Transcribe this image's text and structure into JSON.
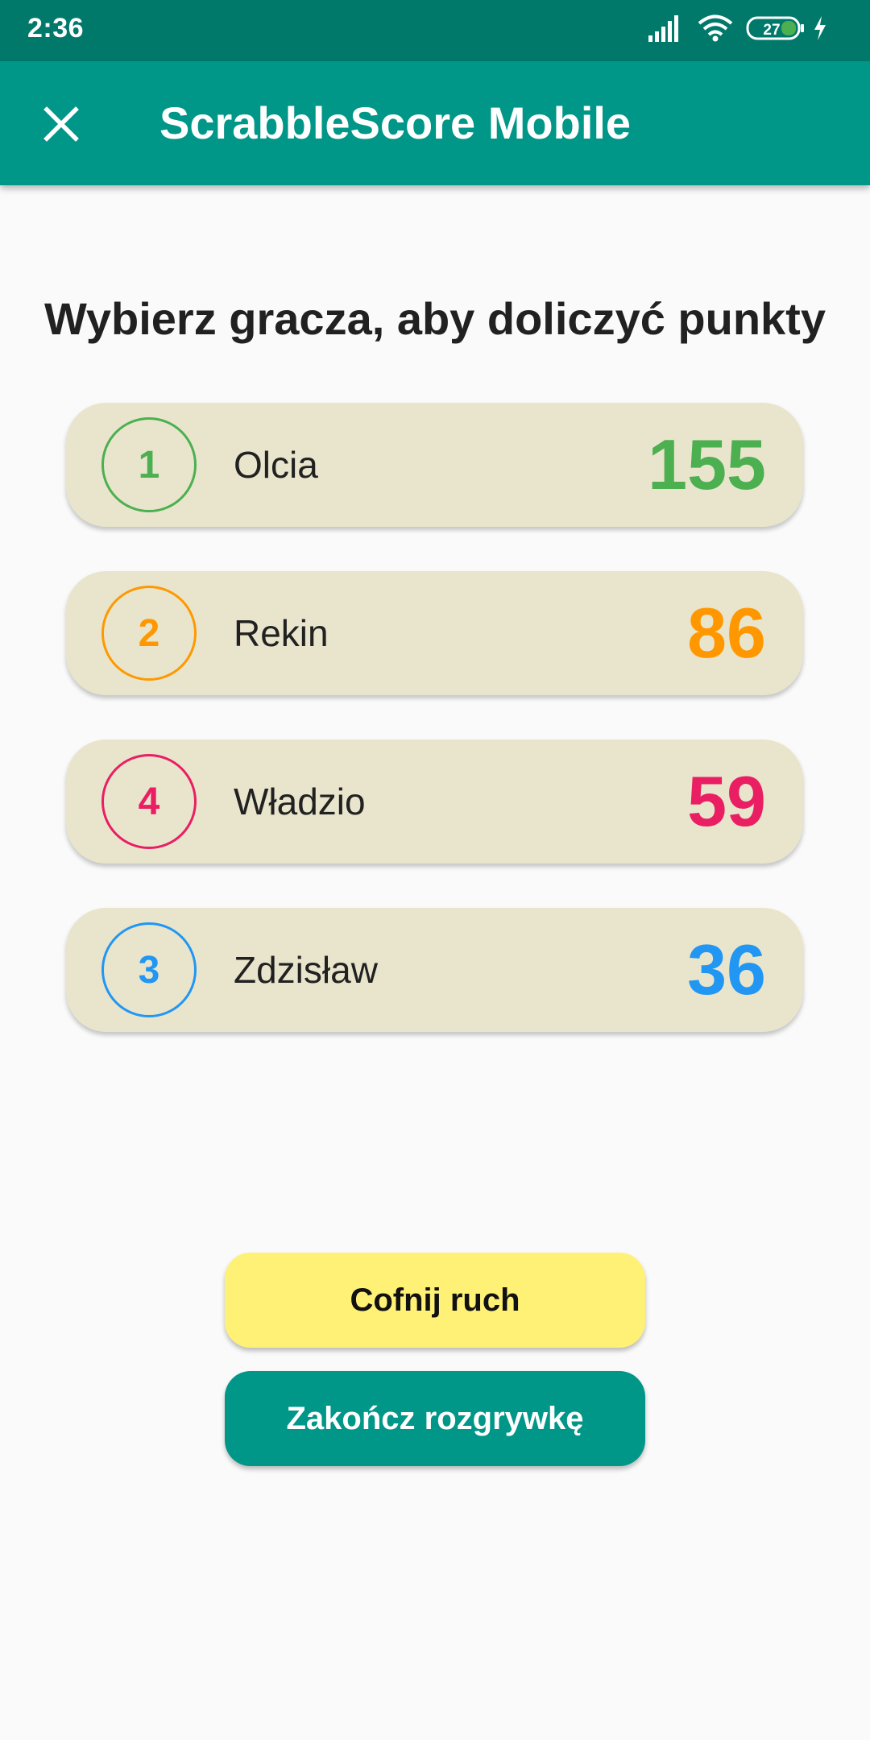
{
  "status_bar": {
    "time": "2:36",
    "battery": "27",
    "icons": [
      "signal-icon",
      "wifi-icon",
      "battery-icon",
      "charging-icon"
    ]
  },
  "app_bar": {
    "title": "ScrabbleScore Mobile",
    "close_icon": "close-icon"
  },
  "heading": "Wybierz gracza, aby doliczyć punkty",
  "players": [
    {
      "rank": "1",
      "name": "Olcia",
      "score": "155",
      "color": "#4caf50"
    },
    {
      "rank": "2",
      "name": "Rekin",
      "score": "86",
      "color": "#ff9800"
    },
    {
      "rank": "4",
      "name": "Władzio",
      "score": "59",
      "color": "#e91e63"
    },
    {
      "rank": "3",
      "name": "Zdzisław",
      "score": "36",
      "color": "#2196f3"
    }
  ],
  "buttons": {
    "undo_label": "Cofnij ruch",
    "end_label": "Zakończ rozgrywkę"
  },
  "colors": {
    "primary": "#009688",
    "primary_dark": "#00796b",
    "card_background": "#e9e5cc",
    "undo_button": "#fff176"
  }
}
